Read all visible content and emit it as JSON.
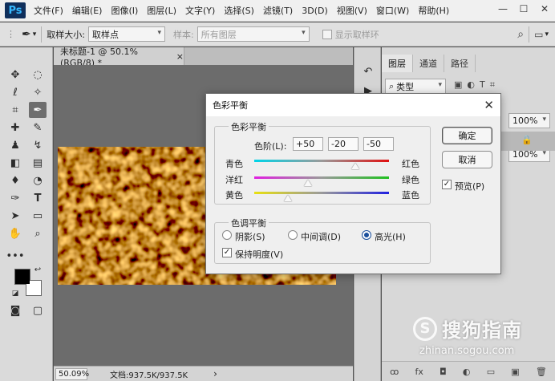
{
  "app": {
    "logo": "Ps"
  },
  "menu": [
    "文件(F)",
    "编辑(E)",
    "图像(I)",
    "图层(L)",
    "文字(Y)",
    "选择(S)",
    "滤镜(T)",
    "3D(D)",
    "视图(V)",
    "窗口(W)",
    "帮助(H)"
  ],
  "window_controls": {
    "minimize": "—",
    "maximize": "☐",
    "close": "✕"
  },
  "options_bar": {
    "sample_size_label": "取样大小:",
    "sample_size_value": "取样点",
    "sample_label": "样本:",
    "sample_value": "所有图层",
    "show_ring_label": "显示取样环"
  },
  "document": {
    "tab_title": "未标题-1 @ 50.1%(RGB/8) *",
    "tab_close": "×",
    "zoom": "50.09%",
    "doc_size": "文档:937.5K/937.5K",
    "status_arrow": "›"
  },
  "layers_panel": {
    "tabs": [
      "图层",
      "通道",
      "路径"
    ],
    "kind_label": "类型",
    "opacity_value": "100%",
    "fill_value": "100%",
    "lock_icon": "🔒",
    "bottom_icons": [
      "ꝏ",
      "fx",
      "◘",
      "◐",
      "▭",
      "▣",
      "🗑"
    ]
  },
  "dialog": {
    "title": "色彩平衡",
    "close": "✕",
    "balance_group": "色彩平衡",
    "levels_label": "色阶(L):",
    "levels": [
      "+50",
      "-20",
      "-50"
    ],
    "sliders": [
      {
        "left": "青色",
        "right": "红色",
        "value": 50,
        "from": "#00d4e8",
        "to": "#e01010"
      },
      {
        "left": "洋红",
        "right": "绿色",
        "value": -20,
        "from": "#e020e0",
        "to": "#20c020"
      },
      {
        "left": "黄色",
        "right": "蓝色",
        "value": -50,
        "from": "#e8e010",
        "to": "#2020e0"
      }
    ],
    "tone_group": "色调平衡",
    "tones": [
      "阴影(S)",
      "中间调(D)",
      "高光(H)"
    ],
    "selected_tone": "高光(H)",
    "preserve_label": "保持明度(V)",
    "preserve_checked": true,
    "ok_label": "确定",
    "cancel_label": "取消",
    "preview_label": "预览(P)",
    "preview_checked": true
  },
  "watermark": {
    "text": "搜狗指南",
    "url": "zhinan.sogou.com"
  },
  "colors": {
    "foreground": "#000000",
    "background": "#ffffff"
  }
}
